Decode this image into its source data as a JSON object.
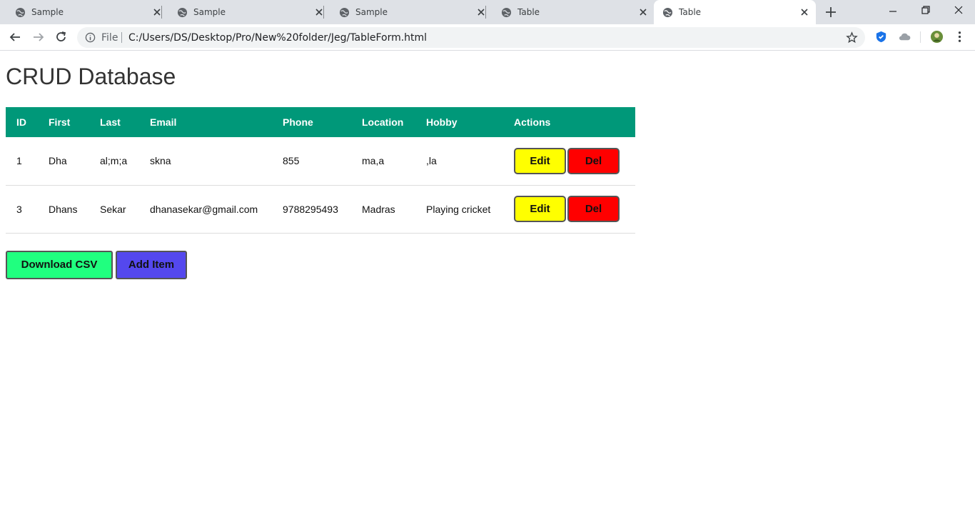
{
  "browser": {
    "tabs": [
      {
        "title": "Sample",
        "active": false
      },
      {
        "title": "Sample",
        "active": false
      },
      {
        "title": "Sample",
        "active": false
      },
      {
        "title": "Table",
        "active": false
      },
      {
        "title": "Table",
        "active": true
      }
    ],
    "address": {
      "scheme_label": "File",
      "url": "C:/Users/DS/Desktop/Pro/New%20folder/Jeg/TableForm.html"
    }
  },
  "page": {
    "title": "CRUD Database",
    "table": {
      "headers": [
        "ID",
        "First",
        "Last",
        "Email",
        "Phone",
        "Location",
        "Hobby",
        "Actions"
      ],
      "rows": [
        {
          "id": "1",
          "first": "Dha",
          "last": "al;m;a",
          "email": "skna",
          "phone": "855",
          "location": "ma,a",
          "hobby": ",la"
        },
        {
          "id": "3",
          "first": "Dhans",
          "last": "Sekar",
          "email": "dhanasekar@gmail.com",
          "phone": "9788295493",
          "location": "Madras",
          "hobby": "Playing cricket"
        }
      ],
      "edit_label": "Edit",
      "delete_label": "Del"
    },
    "download_csv_label": "Download CSV",
    "add_item_label": "Add Item"
  },
  "colors": {
    "header_bg": "#009879",
    "edit_button": "#ffff00",
    "delete_button": "#ff0000",
    "download_button": "#20ff7f",
    "add_button": "#5448ee"
  }
}
